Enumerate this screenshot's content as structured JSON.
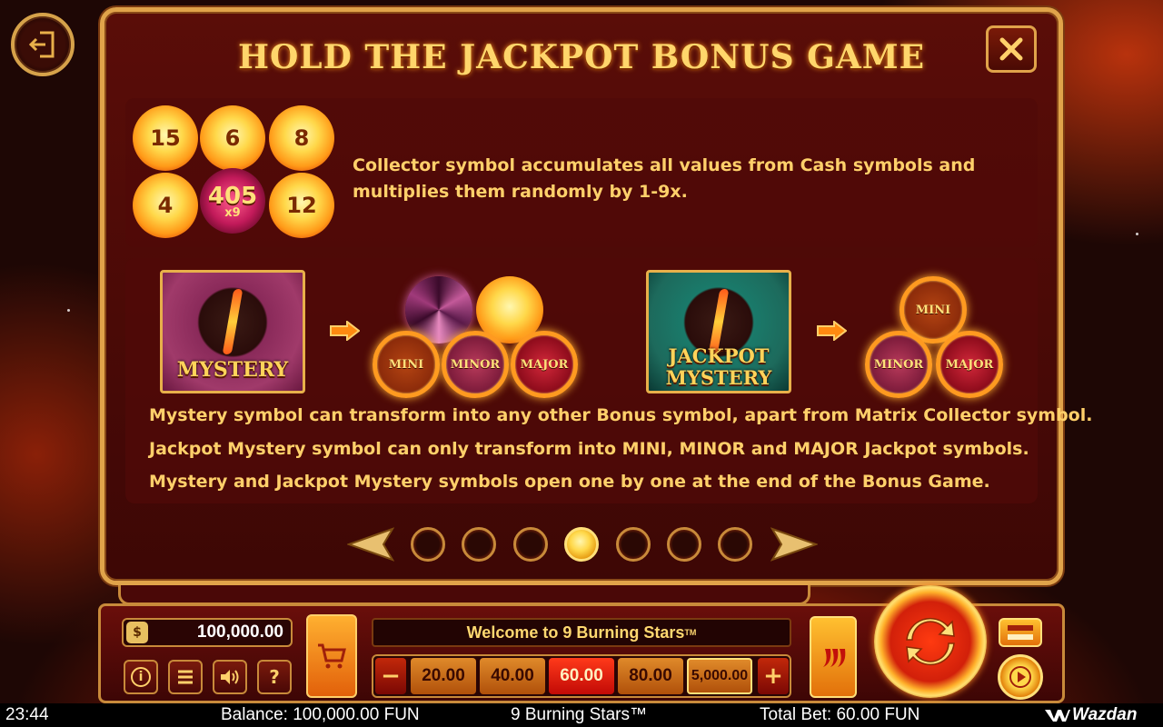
{
  "header": {
    "title": "HOLD THE JACKPOT BONUS GAME"
  },
  "collector_section": {
    "cash_values": [
      "15",
      "6",
      "8",
      "4",
      "12"
    ],
    "collector_value": "405",
    "collector_multiplier": "x9",
    "description": "Collector symbol accumulates all values from Cash symbols and multiplies them randomly by 1-9x."
  },
  "mystery_section": {
    "mystery_label": "MYSTERY",
    "jackpot_mystery_label_1": "JACKPOT",
    "jackpot_mystery_label_2": "MYSTERY",
    "jackpots": {
      "mini": "MINI",
      "minor": "MINOR",
      "major": "MAJOR"
    },
    "rules": [
      "Mystery symbol can transform into any other Bonus symbol, apart from Matrix Collector symbol.",
      "Jackpot Mystery symbol can only transform into MINI, MINOR  and MAJOR Jackpot symbols.",
      "Mystery and Jackpot Mystery symbols open one by one at the end of the Bonus Game."
    ]
  },
  "pager": {
    "total_pages": 7,
    "current_page": 4
  },
  "controls": {
    "balance_display": "100,000.00",
    "bag_icon_text": "$",
    "info_label": "i",
    "help_label": "?",
    "welcome_text": "Welcome to 9 Burning Stars",
    "welcome_tm": "TM",
    "minus_label": "−",
    "plus_label": "+",
    "bets": [
      "20.00",
      "40.00",
      "60.00",
      "80.00",
      "5,000.00"
    ],
    "selected_bet": "60.00"
  },
  "status_bar": {
    "time": "23:44",
    "balance": "Balance: 100,000.00 FUN",
    "game_name": "9 Burning Stars™",
    "total_bet": "Total Bet: 60.00 FUN",
    "brand": "Wazdan"
  },
  "colors": {
    "accent_gold": "#ffd06a",
    "frame_gold": "#e0a34a",
    "panel_red": "#4a0807"
  }
}
